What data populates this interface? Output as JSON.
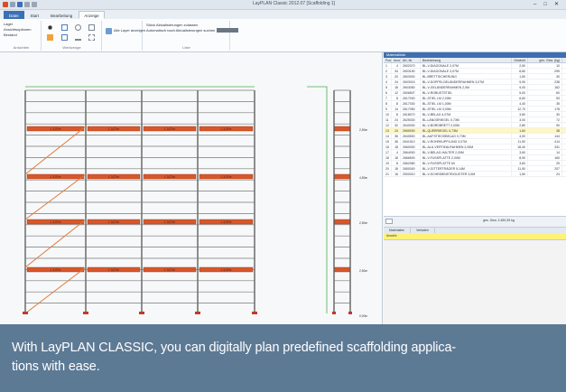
{
  "app": {
    "title": "LayPLAN Classic 2012.07 [Scaffolding 1]",
    "window_controls": [
      "–",
      "□",
      "✕"
    ]
  },
  "ribbon": {
    "tabs": [
      "Datei",
      "Start",
      "Bearbeitung",
      "Anzeige"
    ],
    "active_tab": "Anzeige",
    "groups": [
      {
        "label": "Ansichten",
        "items": [
          "Lager",
          "Ansichtsoptionen",
          "Bestand"
        ]
      },
      {
        "label": "Werkzeuge",
        "items": []
      },
      {
        "label": "",
        "items": [
          "Alle Layer anzeigen"
        ]
      },
      {
        "label": "Liste",
        "items": [
          "Stück Aktualisierungen zulassen",
          "Automatisch nach Aktualisierungen suchen"
        ]
      }
    ]
  },
  "panel": {
    "header": "Materialliste",
    "columns": [
      "Pos.",
      "Anzahl",
      "Art.-Nr.",
      "Bezeichnung",
      "Gewicht",
      "ges. Gew. (kg)"
    ],
    "rows": [
      [
        "1",
        "4",
        "2602070",
        "BL-V-DIAGONALE 2,07M",
        "2,50",
        "10"
      ],
      [
        "2",
        "34",
        "2603150",
        "BL-V-DIAGONALE 3,07M",
        "8,80",
        "299"
      ],
      [
        "3",
        "20",
        "2603000",
        "BL-BRETTSICHERUNG",
        "1,50",
        "30"
      ],
      [
        "4",
        "24",
        "2603015",
        "BL-V-DOPPELGELÄNDERRAHMEN 3,07M",
        "9,90",
        "238"
      ],
      [
        "5",
        "18",
        "2603050",
        "BL-V-GELÄNDERRAHMEN 2,0M",
        "9,00",
        "162"
      ],
      [
        "6",
        "12",
        "2606507",
        "BL-V-ROBUSTSTIEL",
        "5,00",
        "60"
      ],
      [
        "7",
        "8",
        "2617000",
        "BL-STIEL LM 2,00M",
        "6,60",
        "53"
      ],
      [
        "8",
        "8",
        "2617030",
        "BL-STIEL LM 1,00M",
        "4,40",
        "35"
      ],
      [
        "9",
        "14",
        "2617050",
        "BL-STIEL LM 3,00M",
        "12,70",
        "178"
      ],
      [
        "10",
        "8",
        "2618070",
        "BL-V-BELAG 4,07M",
        "3,80",
        "30"
      ],
      [
        "11",
        "24",
        "2625030",
        "BL-LÄNGSRIEGEL 0,73M",
        "3,00",
        "72"
      ],
      [
        "12",
        "32",
        "2640000",
        "BL-V-BORDBRETT 2,00M",
        "2,80",
        "90"
      ],
      [
        "13",
        "24",
        "2659000",
        "BL-QUERRIEGEL 0,73M",
        "1,60",
        "38"
      ],
      [
        "14",
        "36",
        "2640500",
        "BL-AUFSTIEGSBELAG 0,73M",
        "4,00",
        "144"
      ],
      [
        "15",
        "36",
        "2641510",
        "BL-V-ROHRKUPPLUNG 3,07M",
        "11,50",
        "414"
      ],
      [
        "16",
        "18",
        "2660000",
        "BL-ALU-VERTIKALRAHMEN 2,00M",
        "18,40",
        "331"
      ],
      [
        "17",
        "4",
        "2664000",
        "BL-V-BELAG-HALTER 2,00M",
        "3,60",
        "14"
      ],
      [
        "18",
        "18",
        "2666500",
        "BL-V-FUSSPLATTE 2,00M",
        "8,90",
        "160"
      ],
      [
        "19",
        "8",
        "2662080",
        "BL-V-FUSSPLATTE 60",
        "3,60",
        "29"
      ],
      [
        "20",
        "18",
        "2650000",
        "BL-V-GITTERTRÄGER 5,14M",
        "11,50",
        "207"
      ],
      [
        "21",
        "16",
        "2500010",
        "BL-V-SCHEIBENSTEIGLEITER 3,0M",
        "1,50",
        "24"
      ]
    ],
    "selected_row": 12,
    "footer_summary": "ges. Gew. 2.450,39 kg",
    "tabs": [
      "Materialien",
      "Verladen"
    ],
    "hint": "Ansicht"
  },
  "drawing": {
    "level_labels": [
      "2,50m",
      "4,50m",
      "2,50m",
      "2,50m",
      "0,00m"
    ],
    "bay_labels": [
      "L 3,07m",
      "L 3,07m",
      "L 3,07m",
      "L 3,07m"
    ],
    "side_labels": [
      "L 0,73m",
      "L 0,73m",
      "L 0,73m",
      "L 0,73m"
    ]
  },
  "caption": "With LayPLAN CLASSIC, you can digitally plan predefined scaffolding applica-\ntions with ease.",
  "colors": {
    "caption_bg": "#5d7a95",
    "deck": "#d8572a",
    "frame": "#555555",
    "selected_row": "#fff7c4",
    "hint": "#fff27a",
    "tab_file": "#3b6fb6"
  }
}
